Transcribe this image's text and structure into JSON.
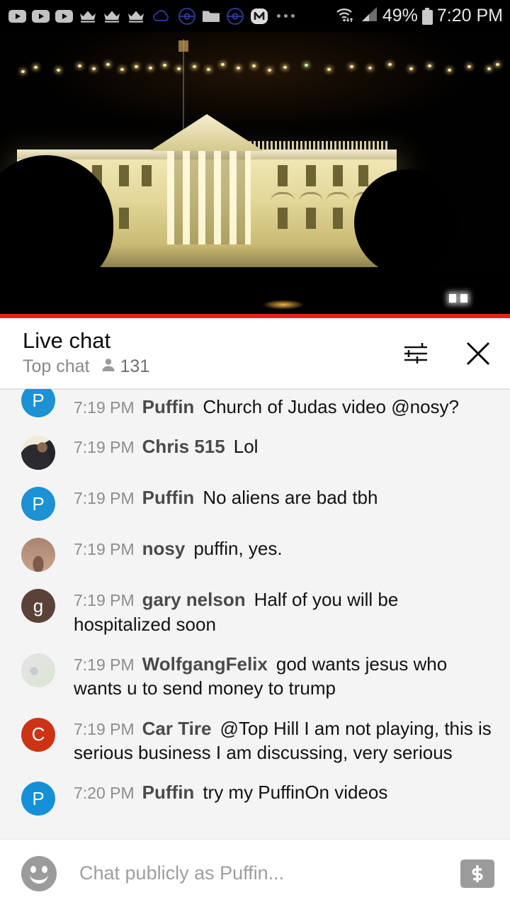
{
  "statusbar": {
    "icons": [
      {
        "name": "youtube-icon",
        "label": "YouTube"
      },
      {
        "name": "youtube-icon",
        "label": "YouTube"
      },
      {
        "name": "youtube-icon",
        "label": "YouTube"
      },
      {
        "name": "crown-icon",
        "label": "Crown"
      },
      {
        "name": "crown-icon",
        "label": "Crown"
      },
      {
        "name": "crown-icon",
        "label": "Crown"
      },
      {
        "name": "cloud-icon",
        "label": "Cloud"
      },
      {
        "name": "pokeball-icon",
        "label": "Pokeball"
      },
      {
        "name": "folder-icon",
        "label": "Folder"
      },
      {
        "name": "pokeball-icon",
        "label": "Pokeball"
      },
      {
        "name": "m-app-icon",
        "label": "M"
      },
      {
        "name": "more-dots-icon",
        "label": "More notifications"
      }
    ],
    "wifi": "wifi-icon",
    "signal": "cell-signal-icon",
    "battery_percent": "49%",
    "battery": "battery-icon",
    "time": "7:20 PM"
  },
  "video": {
    "name": "live-video-player",
    "description": "White House at night live stream",
    "progress_color": "#e62117",
    "progress_percent": 100
  },
  "chat_header": {
    "title": "Live chat",
    "subtitle": "Top chat",
    "viewer_count": "131",
    "viewer_icon": "person-icon",
    "filter_icon": "chat-settings-icon",
    "close_icon": "close-icon"
  },
  "messages": [
    {
      "time": "7:19 PM",
      "author": "Puffin",
      "text": "Church of Judas video @nosy?",
      "avatar_type": "letter",
      "avatar_letter": "P",
      "avatar_color": "#1c91d4",
      "partial": true
    },
    {
      "time": "7:19 PM",
      "author": "Chris 515",
      "text": "Lol",
      "avatar_type": "photo",
      "avatar_letter": "",
      "avatar_color": "#e8e2d6",
      "partial": false
    },
    {
      "time": "7:19 PM",
      "author": "Puffin",
      "text": "No aliens are bad tbh",
      "avatar_type": "letter",
      "avatar_letter": "P",
      "avatar_color": "#1c91d4",
      "partial": false
    },
    {
      "time": "7:19 PM",
      "author": "nosy",
      "text": "puffin, yes.",
      "avatar_type": "photo",
      "avatar_letter": "",
      "avatar_color": "#a98470",
      "partial": false
    },
    {
      "time": "7:19 PM",
      "author": "gary nelson",
      "text": "Half of you will be hospitalized soon",
      "avatar_type": "letter",
      "avatar_letter": "g",
      "avatar_color": "#5b4239",
      "partial": false
    },
    {
      "time": "7:19 PM",
      "author": "WolfgangFelix",
      "text": "god wants jesus who wants u to send money to trump",
      "avatar_type": "photo",
      "avatar_letter": "",
      "avatar_color": "#dfe6d8",
      "partial": false
    },
    {
      "time": "7:19 PM",
      "author": "Car Tire",
      "text": "@Top Hill I am not playing, this is serious business I am discussing, very serious",
      "avatar_type": "letter",
      "avatar_letter": "C",
      "avatar_color": "#cc3314",
      "partial": false
    },
    {
      "time": "7:20 PM",
      "author": "Puffin",
      "text": "try my PuffinOn videos",
      "avatar_type": "letter",
      "avatar_letter": "P",
      "avatar_color": "#1390d8",
      "partial": false
    }
  ],
  "input_bar": {
    "emoji_icon": "emoji-smiley-icon",
    "placeholder": "Chat publicly as Puffin...",
    "value": "",
    "superchat_icon": "super-chat-dollar-icon"
  }
}
